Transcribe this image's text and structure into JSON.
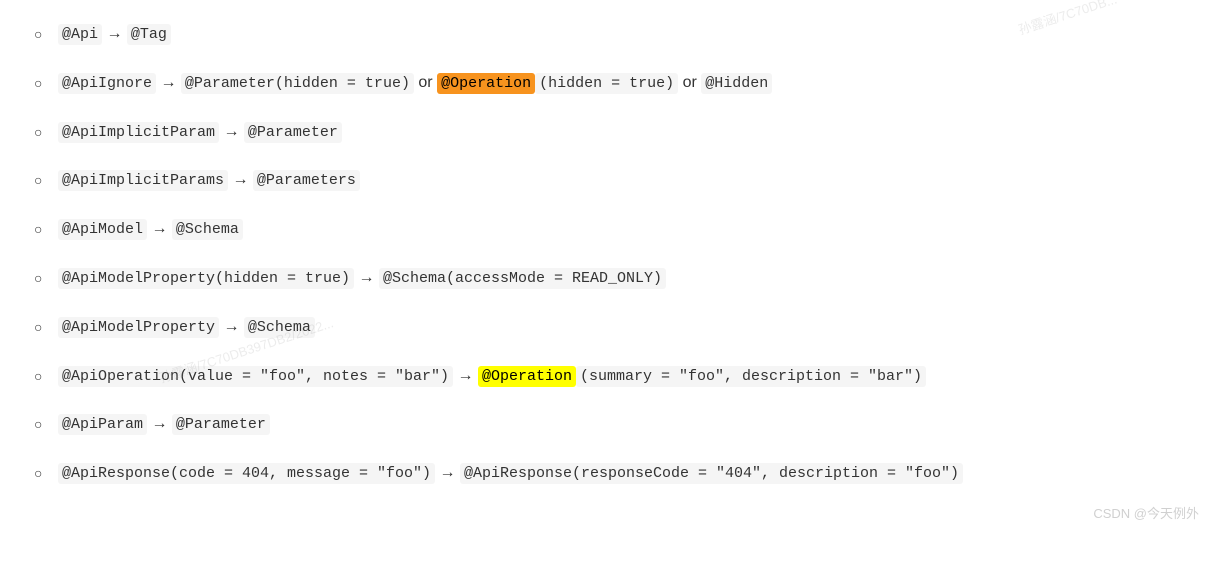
{
  "items": [
    {
      "parts": [
        {
          "t": "code",
          "v": "@Api"
        },
        {
          "t": "plain",
          "v": " → "
        },
        {
          "t": "code",
          "v": "@Tag"
        }
      ]
    },
    {
      "parts": [
        {
          "t": "code",
          "v": "@ApiIgnore"
        },
        {
          "t": "plain",
          "v": " → "
        },
        {
          "t": "code",
          "v": "@Parameter(hidden = true)"
        },
        {
          "t": "plain",
          "v": " or "
        },
        {
          "t": "code",
          "v": "@Operation",
          "hl": "orange",
          "partial": true
        },
        {
          "t": "code",
          "v": "(hidden = true)"
        },
        {
          "t": "plain",
          "v": " or "
        },
        {
          "t": "code",
          "v": "@Hidden"
        }
      ]
    },
    {
      "parts": [
        {
          "t": "code",
          "v": "@ApiImplicitParam"
        },
        {
          "t": "plain",
          "v": " → "
        },
        {
          "t": "code",
          "v": "@Parameter"
        }
      ]
    },
    {
      "parts": [
        {
          "t": "code",
          "v": "@ApiImplicitParams"
        },
        {
          "t": "plain",
          "v": " → "
        },
        {
          "t": "code",
          "v": "@Parameters"
        }
      ]
    },
    {
      "parts": [
        {
          "t": "code",
          "v": "@ApiModel"
        },
        {
          "t": "plain",
          "v": " → "
        },
        {
          "t": "code",
          "v": "@Schema"
        }
      ]
    },
    {
      "parts": [
        {
          "t": "code",
          "v": "@ApiModelProperty(hidden = true)"
        },
        {
          "t": "plain",
          "v": " → "
        },
        {
          "t": "code",
          "v": "@Schema(accessMode = READ_ONLY)"
        }
      ]
    },
    {
      "parts": [
        {
          "t": "code",
          "v": "@ApiModelProperty"
        },
        {
          "t": "plain",
          "v": " → "
        },
        {
          "t": "code",
          "v": "@Schema"
        }
      ]
    },
    {
      "parts": [
        {
          "t": "code",
          "v": "@ApiOperation(value = \"foo\", notes = \"bar\")"
        },
        {
          "t": "plain",
          "v": " → "
        },
        {
          "t": "code",
          "v": "@Operation",
          "hl": "yellow",
          "partial": true
        },
        {
          "t": "code",
          "v": "(summary = \"foo\", description = \"bar\")"
        }
      ]
    },
    {
      "parts": [
        {
          "t": "code",
          "v": "@ApiParam"
        },
        {
          "t": "plain",
          "v": " → "
        },
        {
          "t": "code",
          "v": "@Parameter"
        }
      ]
    },
    {
      "parts": [
        {
          "t": "code",
          "v": "@ApiResponse(code = 404, message = \"foo\")"
        },
        {
          "t": "plain",
          "v": " → "
        },
        {
          "t": "code",
          "v": "@ApiResponse(responseCode = \"404\", description = \"foo\")"
        }
      ]
    }
  ],
  "watermarks": {
    "wm1": "孙露涵/7C70DB...",
    "wm2": "孙露涵/7C70DB397DB2/2022..."
  },
  "footer": "CSDN @今天例外"
}
